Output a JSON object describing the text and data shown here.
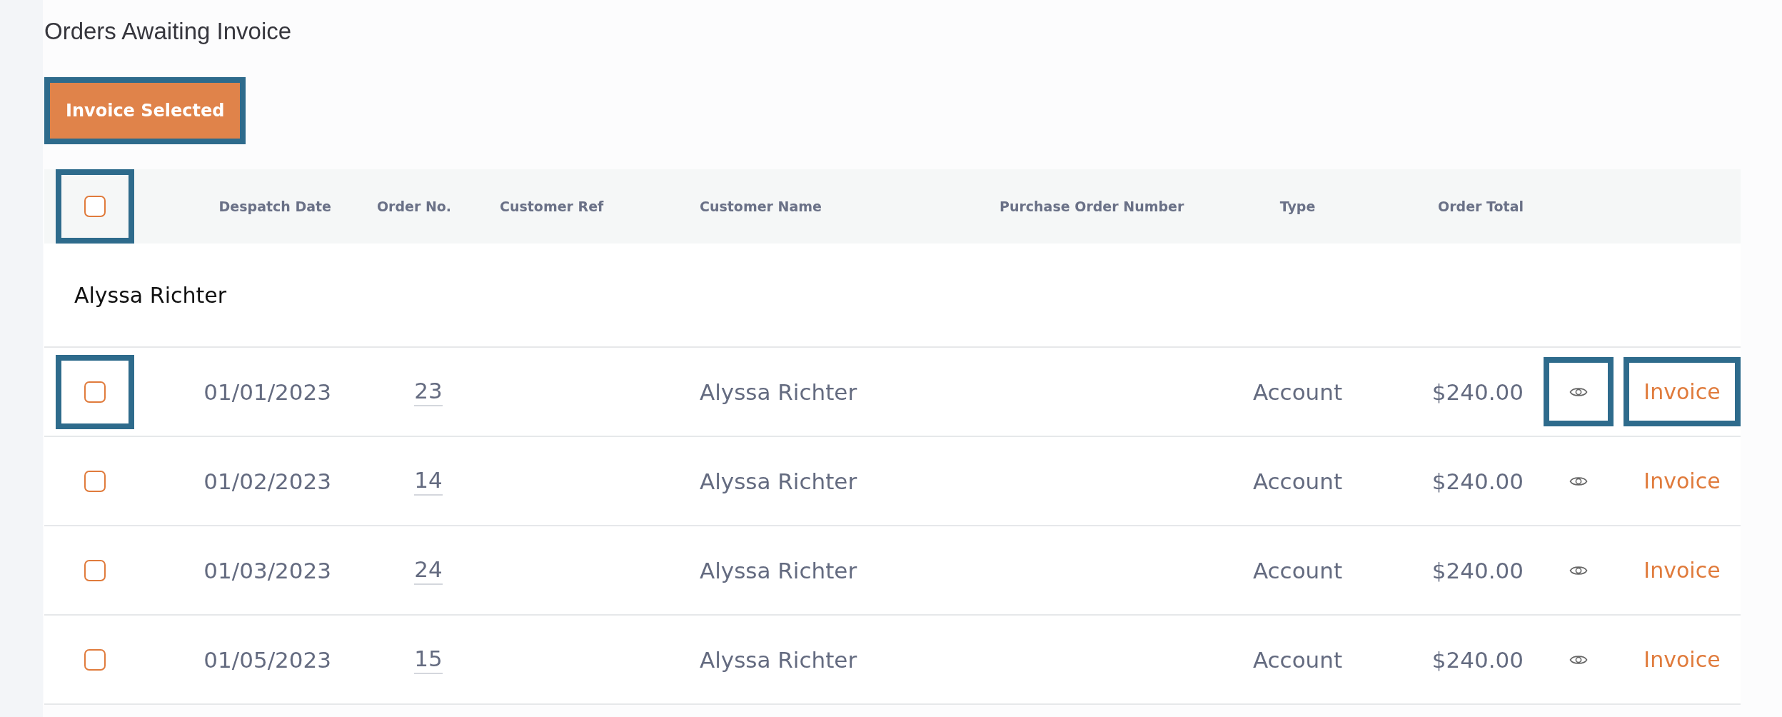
{
  "title": "Orders Awaiting Invoice",
  "invoice_selected_button": {
    "label": "Invoice Selected",
    "highlighted": true
  },
  "table": {
    "select_all": {
      "checked": false,
      "highlighted": true
    },
    "columns": [
      "Despatch Date",
      "Order No.",
      "Customer Ref",
      "Customer Name",
      "Purchase Order Number",
      "Type",
      "Order Total"
    ],
    "groups": [
      {
        "name": "Alyssa Richter",
        "rows": [
          {
            "checked": false,
            "checkbox_highlighted": true,
            "despatch_date": "01/01/2023",
            "order_no": "23",
            "customer_name": "Alyssa Richter",
            "type": "Account",
            "order_total": "$240.00",
            "view_highlighted": true,
            "invoice_label": "Invoice",
            "invoice_highlighted": true
          },
          {
            "checked": false,
            "checkbox_highlighted": false,
            "despatch_date": "01/02/2023",
            "order_no": "14",
            "customer_name": "Alyssa Richter",
            "type": "Account",
            "order_total": "$240.00",
            "view_highlighted": false,
            "invoice_label": "Invoice",
            "invoice_highlighted": false
          },
          {
            "checked": false,
            "checkbox_highlighted": false,
            "despatch_date": "01/03/2023",
            "order_no": "24",
            "customer_name": "Alyssa Richter",
            "type": "Account",
            "order_total": "$240.00",
            "view_highlighted": false,
            "invoice_label": "Invoice",
            "invoice_highlighted": false
          },
          {
            "checked": false,
            "checkbox_highlighted": false,
            "despatch_date": "01/05/2023",
            "order_no": "15",
            "customer_name": "Alyssa Richter",
            "type": "Account",
            "order_total": "$240.00",
            "view_highlighted": false,
            "invoice_label": "Invoice",
            "invoice_highlighted": false
          }
        ]
      }
    ]
  }
}
